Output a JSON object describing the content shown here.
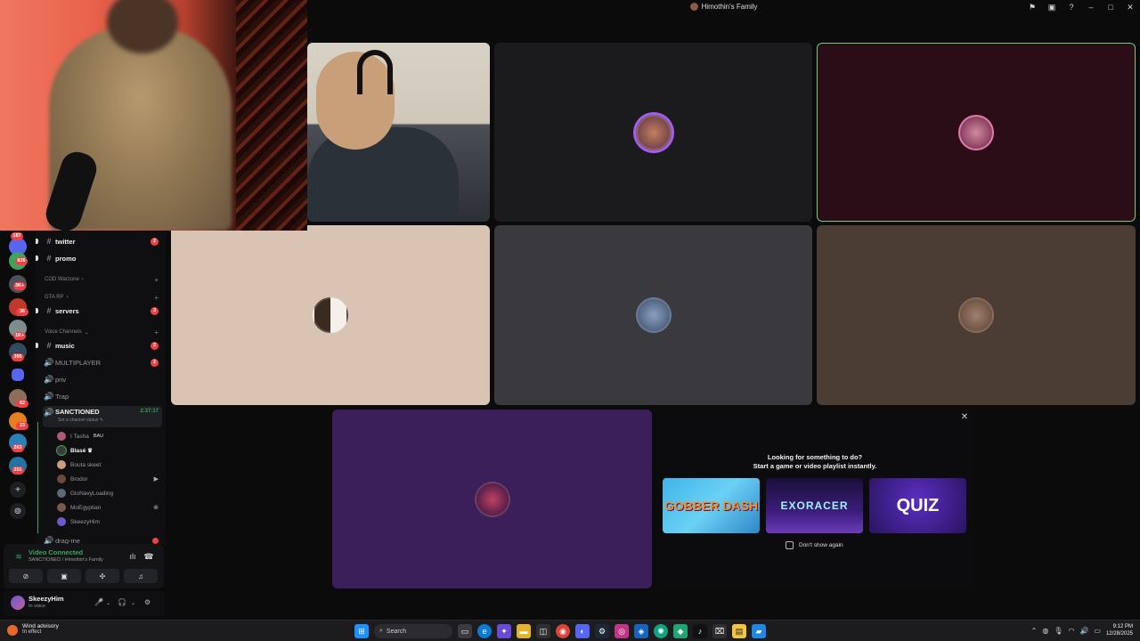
{
  "window": {
    "title": "Himothin's Family",
    "controls": [
      "⚑",
      "▣",
      "?",
      "–",
      "□",
      "✕"
    ]
  },
  "rail": {
    "badges": [
      "187",
      "826",
      "3K+",
      "36",
      "1K+",
      "395",
      "62",
      "23",
      "263",
      "251"
    ],
    "add_label": "+",
    "discover_label": "⊚"
  },
  "channels": {
    "text_items": [
      {
        "name": "twitter",
        "count": "2"
      },
      {
        "name": "promo",
        "count": ""
      }
    ],
    "categories": {
      "cod": "COD Warzone",
      "gta": "GTA RP",
      "voice": "Voice Channels"
    },
    "servers": {
      "name": "servers",
      "count": "3"
    },
    "music": {
      "name": "music",
      "count": "2"
    },
    "multiplayer": {
      "name": "MULTIPLAYER",
      "count": "2"
    },
    "priv": "priv",
    "trap": "Trap",
    "active_voice": {
      "name": "SANCTIONED",
      "time": "2:37:17",
      "status_placeholder": "Set a channel status ✎"
    },
    "members": [
      {
        "name": "I Tasha",
        "tag": "BAU"
      },
      {
        "name": "Blasé ♛",
        "tag": ""
      },
      {
        "name": "Bouta skeet",
        "tag": ""
      },
      {
        "name": "Brodor",
        "tag": "▶"
      },
      {
        "name": "GloNavyLoading",
        "tag": ""
      },
      {
        "name": "MoEgyptian",
        "tag": "⊗"
      },
      {
        "name": "SkeezyHim",
        "tag": ""
      }
    ],
    "next_channel": "drag-me"
  },
  "voice_panel": {
    "status": "Video Connected",
    "location": "SANCTIONED / Himothin's Family"
  },
  "user": {
    "name": "SkeezyHim",
    "status": "In voice"
  },
  "activity": {
    "title_line1": "Looking for something to do?",
    "title_line2": "Start a game or video playlist instantly.",
    "games": [
      "GOBBER DASH",
      "EXORACER",
      "QUIZ"
    ],
    "dont_show": "Don't show again"
  },
  "taskbar": {
    "weather_title": "Wind advisory",
    "weather_sub": "In effect",
    "search_label": "Search",
    "time": "9:12 PM",
    "date": "12/28/2025"
  }
}
